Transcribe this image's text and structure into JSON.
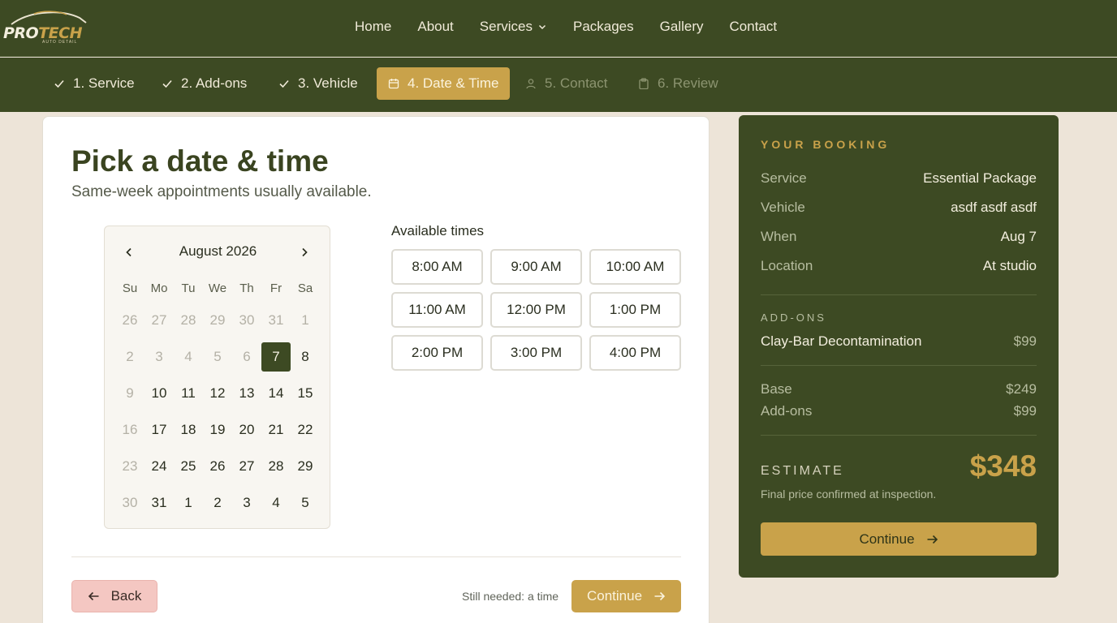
{
  "brand": {
    "logo_text_a": "PRO",
    "logo_text_b": "TECH",
    "logo_sub": "AUTO DETAIL"
  },
  "nav": {
    "items": [
      {
        "label": "Home"
      },
      {
        "label": "About"
      },
      {
        "label": "Services",
        "has_dropdown": true
      },
      {
        "label": "Packages"
      },
      {
        "label": "Gallery"
      },
      {
        "label": "Contact"
      }
    ]
  },
  "stepper": {
    "steps": [
      {
        "label": "1. Service",
        "state": "done",
        "icon": "check-icon"
      },
      {
        "label": "2. Add-ons",
        "state": "done",
        "icon": "check-icon"
      },
      {
        "label": "3. Vehicle",
        "state": "done",
        "icon": "check-icon"
      },
      {
        "label": "4. Date & Time",
        "state": "active",
        "icon": "calendar-icon"
      },
      {
        "label": "5. Contact",
        "state": "todo",
        "icon": "user-icon"
      },
      {
        "label": "6. Review",
        "state": "todo",
        "icon": "clipboard-icon"
      }
    ]
  },
  "main": {
    "title": "Pick a date & time",
    "subtitle": "Same-week appointments usually available.",
    "calendar": {
      "month": "August 2026",
      "weekdays": [
        "Su",
        "Mo",
        "Tu",
        "We",
        "Th",
        "Fr",
        "Sa"
      ],
      "days": [
        {
          "d": "26",
          "muted": true
        },
        {
          "d": "27",
          "muted": true
        },
        {
          "d": "28",
          "muted": true
        },
        {
          "d": "29",
          "muted": true
        },
        {
          "d": "30",
          "muted": true
        },
        {
          "d": "31",
          "muted": true
        },
        {
          "d": "1",
          "muted": true
        },
        {
          "d": "2",
          "muted": true
        },
        {
          "d": "3",
          "muted": true
        },
        {
          "d": "4",
          "muted": true
        },
        {
          "d": "5",
          "muted": true
        },
        {
          "d": "6",
          "muted": true
        },
        {
          "d": "7",
          "selected": true
        },
        {
          "d": "8"
        },
        {
          "d": "9",
          "muted": true
        },
        {
          "d": "10"
        },
        {
          "d": "11"
        },
        {
          "d": "12"
        },
        {
          "d": "13"
        },
        {
          "d": "14"
        },
        {
          "d": "15"
        },
        {
          "d": "16",
          "muted": true
        },
        {
          "d": "17"
        },
        {
          "d": "18"
        },
        {
          "d": "19"
        },
        {
          "d": "20"
        },
        {
          "d": "21"
        },
        {
          "d": "22"
        },
        {
          "d": "23",
          "muted": true
        },
        {
          "d": "24"
        },
        {
          "d": "25"
        },
        {
          "d": "26"
        },
        {
          "d": "27"
        },
        {
          "d": "28"
        },
        {
          "d": "29"
        },
        {
          "d": "30",
          "muted": true
        },
        {
          "d": "31"
        },
        {
          "d": "1"
        },
        {
          "d": "2"
        },
        {
          "d": "3"
        },
        {
          "d": "4"
        },
        {
          "d": "5"
        }
      ]
    },
    "times_label": "Available times",
    "times": [
      "8:00 AM",
      "9:00 AM",
      "10:00 AM",
      "11:00 AM",
      "12:00 PM",
      "1:00 PM",
      "2:00 PM",
      "3:00 PM",
      "4:00 PM"
    ],
    "back_label": "Back",
    "still_needed": "Still needed: a time",
    "continue_label": "Continue"
  },
  "booking": {
    "heading": "YOUR BOOKING",
    "rows": [
      {
        "key": "Service",
        "value": "Essential Package"
      },
      {
        "key": "Vehicle",
        "value": "asdf asdf asdf"
      },
      {
        "key": "When",
        "value": "Aug 7"
      },
      {
        "key": "Location",
        "value": "At studio"
      }
    ],
    "addons_heading": "ADD-ONS",
    "addons": [
      {
        "name": "Clay-Bar Decontamination",
        "price": "$99"
      }
    ],
    "base_label": "Base",
    "base_value": "$249",
    "addons_label": "Add-ons",
    "addons_value": "$99",
    "estimate_label": "ESTIMATE",
    "estimate_value": "$348",
    "estimate_note": "Final price confirmed at inspection.",
    "continue_label": "Continue"
  },
  "colors": {
    "olive": "#3d4a23",
    "gold": "#c9a24a",
    "cream": "#ede4d8",
    "back": "#f4c7c2"
  }
}
